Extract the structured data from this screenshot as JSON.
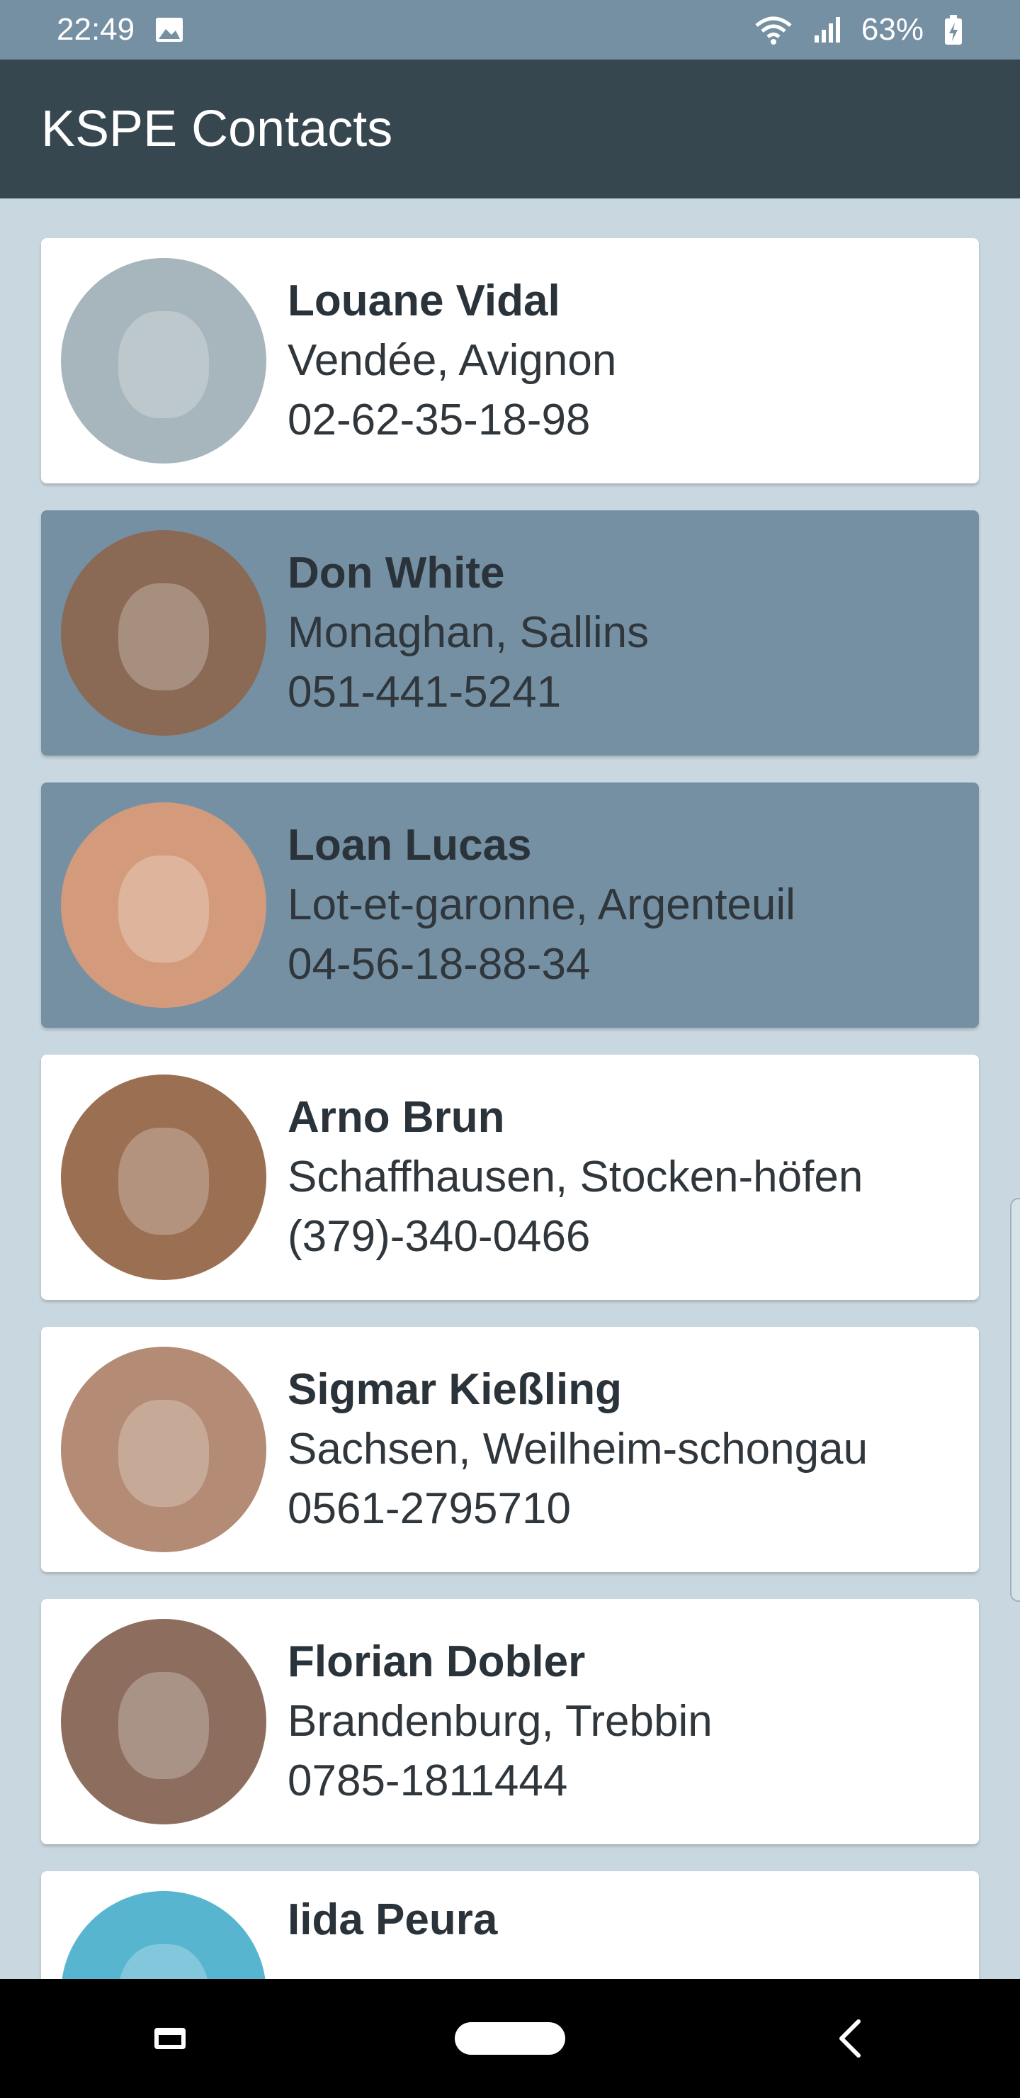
{
  "status_bar": {
    "time": "22:49",
    "battery": "63%"
  },
  "app_bar": {
    "title": "KSPE Contacts"
  },
  "contacts": [
    {
      "name": "Louane Vidal",
      "place": "Vendée, Avignon",
      "phone": "02-62-35-18-98",
      "selected": false,
      "avatar_color": "#a7b6bd"
    },
    {
      "name": "Don White",
      "place": "Monaghan, Sallins",
      "phone": "051-441-5241",
      "selected": true,
      "avatar_color": "#8a6a55"
    },
    {
      "name": "Loan Lucas",
      "place": "Lot-et-garonne, Argenteuil",
      "phone": "04-56-18-88-34",
      "selected": true,
      "avatar_color": "#d39b7b"
    },
    {
      "name": "Arno Brun",
      "place": "Schaffhausen, Stocken-höfen",
      "phone": "(379)-340-0466",
      "selected": false,
      "avatar_color": "#9a6f52"
    },
    {
      "name": "Sigmar Kießling",
      "place": "Sachsen, Weilheim-schongau",
      "phone": "0561-2795710",
      "selected": false,
      "avatar_color": "#b48c76"
    },
    {
      "name": "Florian Dobler",
      "place": "Brandenburg, Trebbin",
      "phone": "0785-1811444",
      "selected": false,
      "avatar_color": "#8d6e5e"
    },
    {
      "name": "Iida Peura",
      "place": "",
      "phone": "",
      "selected": false,
      "avatar_color": "#58b5cf"
    }
  ]
}
